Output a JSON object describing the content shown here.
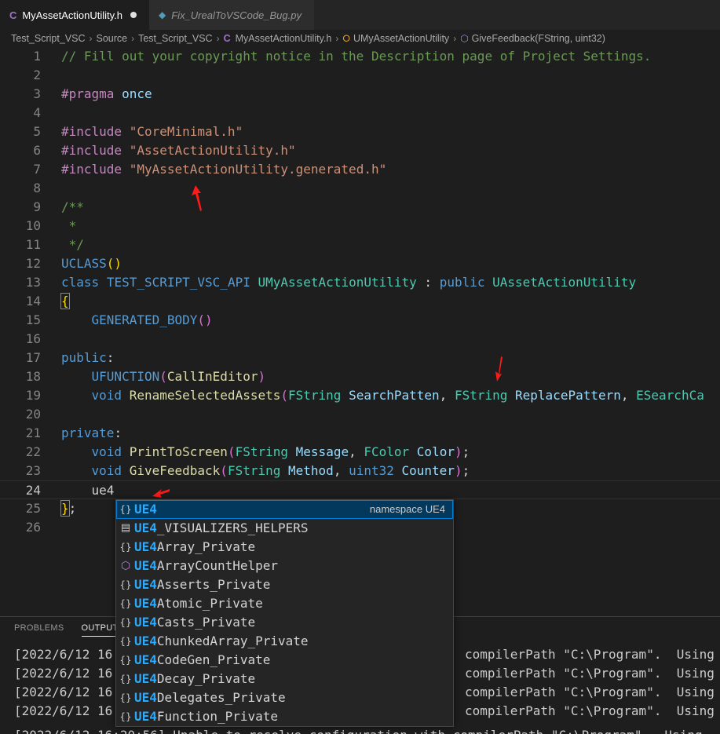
{
  "tabs": [
    {
      "icon": "C",
      "label": "MyAssetActionUtility.h",
      "active": true,
      "modified": true
    },
    {
      "icon": "python-icon",
      "label": "Fix_UrealToVSCode_Bug.py",
      "active": false
    }
  ],
  "breadcrumb": {
    "items": [
      "Test_Script_VSC",
      "Source",
      "Test_Script_VSC",
      "MyAssetActionUtility.h",
      "UMyAssetActionUtility",
      "GiveFeedback(FString, uint32)"
    ],
    "file_icon": "C"
  },
  "editor": {
    "current_line": 24,
    "lines": [
      {
        "n": "1",
        "tokens": [
          {
            "t": "com",
            "v": "// Fill out your copyright notice in the Description page of Project Settings."
          }
        ]
      },
      {
        "n": "2",
        "tokens": []
      },
      {
        "n": "3",
        "tokens": [
          {
            "t": "pp",
            "v": "#pragma"
          },
          {
            "t": "txt",
            "v": " "
          },
          {
            "t": "var",
            "v": "once"
          }
        ]
      },
      {
        "n": "4",
        "tokens": []
      },
      {
        "n": "5",
        "tokens": [
          {
            "t": "pp",
            "v": "#include"
          },
          {
            "t": "txt",
            "v": " "
          },
          {
            "t": "str",
            "v": "\"CoreMinimal.h\""
          }
        ]
      },
      {
        "n": "6",
        "tokens": [
          {
            "t": "pp",
            "v": "#include"
          },
          {
            "t": "txt",
            "v": " "
          },
          {
            "t": "str",
            "v": "\"AssetActionUtility.h\""
          }
        ]
      },
      {
        "n": "7",
        "tokens": [
          {
            "t": "pp",
            "v": "#include"
          },
          {
            "t": "txt",
            "v": " "
          },
          {
            "t": "str",
            "v": "\"MyAssetActionUtility.generated.h\""
          }
        ]
      },
      {
        "n": "8",
        "tokens": []
      },
      {
        "n": "9",
        "tokens": [
          {
            "t": "com",
            "v": "/**"
          }
        ]
      },
      {
        "n": "10",
        "tokens": [
          {
            "t": "com",
            "v": " *"
          }
        ]
      },
      {
        "n": "11",
        "tokens": [
          {
            "t": "com",
            "v": " */"
          }
        ]
      },
      {
        "n": "12",
        "tokens": [
          {
            "t": "mac",
            "v": "UCLASS"
          },
          {
            "t": "br1",
            "v": "()"
          }
        ]
      },
      {
        "n": "13",
        "tokens": [
          {
            "t": "kw",
            "v": "class"
          },
          {
            "t": "txt",
            "v": " "
          },
          {
            "t": "mac",
            "v": "TEST_SCRIPT_VSC_API"
          },
          {
            "t": "txt",
            "v": " "
          },
          {
            "t": "type",
            "v": "UMyAssetActionUtility"
          },
          {
            "t": "txt",
            "v": " : "
          },
          {
            "t": "kw",
            "v": "public"
          },
          {
            "t": "txt",
            "v": " "
          },
          {
            "t": "type",
            "v": "UAssetActionUtility"
          }
        ]
      },
      {
        "n": "14",
        "tokens": [
          {
            "t": "brm",
            "v": "{"
          }
        ]
      },
      {
        "n": "15",
        "tokens": [
          {
            "t": "txt",
            "v": "    "
          },
          {
            "t": "mac",
            "v": "GENERATED_BODY"
          },
          {
            "t": "br2",
            "v": "()"
          }
        ]
      },
      {
        "n": "16",
        "tokens": []
      },
      {
        "n": "17",
        "tokens": [
          {
            "t": "kw",
            "v": "public"
          },
          {
            "t": "txt",
            "v": ":"
          }
        ]
      },
      {
        "n": "18",
        "tokens": [
          {
            "t": "txt",
            "v": "    "
          },
          {
            "t": "mac",
            "v": "UFUNCTION"
          },
          {
            "t": "br2",
            "v": "("
          },
          {
            "t": "fn",
            "v": "CallInEditor"
          },
          {
            "t": "br2",
            "v": ")"
          }
        ]
      },
      {
        "n": "19",
        "tokens": [
          {
            "t": "txt",
            "v": "    "
          },
          {
            "t": "kw",
            "v": "void"
          },
          {
            "t": "txt",
            "v": " "
          },
          {
            "t": "fn",
            "v": "RenameSelectedAssets"
          },
          {
            "t": "br2",
            "v": "("
          },
          {
            "t": "type",
            "v": "FString"
          },
          {
            "t": "txt",
            "v": " "
          },
          {
            "t": "var",
            "v": "SearchPatten"
          },
          {
            "t": "txt",
            "v": ", "
          },
          {
            "t": "type",
            "v": "FString"
          },
          {
            "t": "txt",
            "v": " "
          },
          {
            "t": "var",
            "v": "ReplacePattern"
          },
          {
            "t": "txt",
            "v": ", "
          },
          {
            "t": "type",
            "v": "ESearchCa"
          }
        ]
      },
      {
        "n": "20",
        "tokens": []
      },
      {
        "n": "21",
        "tokens": [
          {
            "t": "kw",
            "v": "private"
          },
          {
            "t": "txt",
            "v": ":"
          }
        ]
      },
      {
        "n": "22",
        "tokens": [
          {
            "t": "txt",
            "v": "    "
          },
          {
            "t": "kw",
            "v": "void"
          },
          {
            "t": "txt",
            "v": " "
          },
          {
            "t": "fn",
            "v": "PrintToScreen"
          },
          {
            "t": "br2",
            "v": "("
          },
          {
            "t": "type",
            "v": "FString"
          },
          {
            "t": "txt",
            "v": " "
          },
          {
            "t": "var",
            "v": "Message"
          },
          {
            "t": "txt",
            "v": ", "
          },
          {
            "t": "type",
            "v": "FColor"
          },
          {
            "t": "txt",
            "v": " "
          },
          {
            "t": "var",
            "v": "Color"
          },
          {
            "t": "br2",
            "v": ")"
          },
          {
            "t": "txt",
            "v": ";"
          }
        ]
      },
      {
        "n": "23",
        "tokens": [
          {
            "t": "txt",
            "v": "    "
          },
          {
            "t": "kw",
            "v": "void"
          },
          {
            "t": "txt",
            "v": " "
          },
          {
            "t": "fn",
            "v": "GiveFeedback"
          },
          {
            "t": "br2",
            "v": "("
          },
          {
            "t": "type",
            "v": "FString"
          },
          {
            "t": "txt",
            "v": " "
          },
          {
            "t": "var",
            "v": "Method"
          },
          {
            "t": "txt",
            "v": ", "
          },
          {
            "t": "kw",
            "v": "uint32"
          },
          {
            "t": "txt",
            "v": " "
          },
          {
            "t": "var",
            "v": "Counter"
          },
          {
            "t": "br2",
            "v": ")"
          },
          {
            "t": "txt",
            "v": ";"
          }
        ]
      },
      {
        "n": "24",
        "tokens": [
          {
            "t": "txt",
            "v": "    ue4"
          }
        ]
      },
      {
        "n": "25",
        "tokens": [
          {
            "t": "brm",
            "v": "}"
          },
          {
            "t": "txt",
            "v": ";"
          }
        ]
      },
      {
        "n": "26",
        "tokens": []
      }
    ]
  },
  "suggest": {
    "typed": "UE4",
    "items": [
      {
        "icon": "namespace-icon",
        "rest": "",
        "detail": "namespace UE4",
        "selected": true
      },
      {
        "icon": "macro-icon",
        "rest": "_VISUALIZERS_HELPERS"
      },
      {
        "icon": "namespace-icon",
        "rest": "Array_Private"
      },
      {
        "icon": "class-icon",
        "rest": "ArrayCountHelper"
      },
      {
        "icon": "namespace-icon",
        "rest": "Asserts_Private"
      },
      {
        "icon": "namespace-icon",
        "rest": "Atomic_Private"
      },
      {
        "icon": "namespace-icon",
        "rest": "Casts_Private"
      },
      {
        "icon": "namespace-icon",
        "rest": "ChunkedArray_Private"
      },
      {
        "icon": "namespace-icon",
        "rest": "CodeGen_Private"
      },
      {
        "icon": "namespace-icon",
        "rest": "Decay_Private"
      },
      {
        "icon": "namespace-icon",
        "rest": "Delegates_Private"
      },
      {
        "icon": "namespace-icon",
        "rest": "Function_Private"
      }
    ]
  },
  "panel": {
    "tabs": [
      {
        "label": "PROBLEMS",
        "active": false
      },
      {
        "label": "OUTPUT",
        "active": true
      }
    ],
    "output_lines": [
      {
        "ts": "[2022/6/12 16",
        "msg": "compilerPath \"C:\\Program\".  Using"
      },
      {
        "ts": "[2022/6/12 16",
        "msg": "compilerPath \"C:\\Program\".  Using"
      },
      {
        "ts": "[2022/6/12 16",
        "msg": "compilerPath \"C:\\Program\".  Using"
      },
      {
        "ts": "[2022/6/12 16",
        "msg": "compilerPath \"C:\\Program\".  Using"
      }
    ],
    "last_line": "[2022/6/12 16:20:56] Unable to resolve configuration with compilerPath \"C:\\Program\".  Using"
  },
  "colors": {
    "editor_bg": "#1e1e1e",
    "selection": "#04395e",
    "highlight": "#2aaaff",
    "arrow": "#ff1a1a"
  }
}
